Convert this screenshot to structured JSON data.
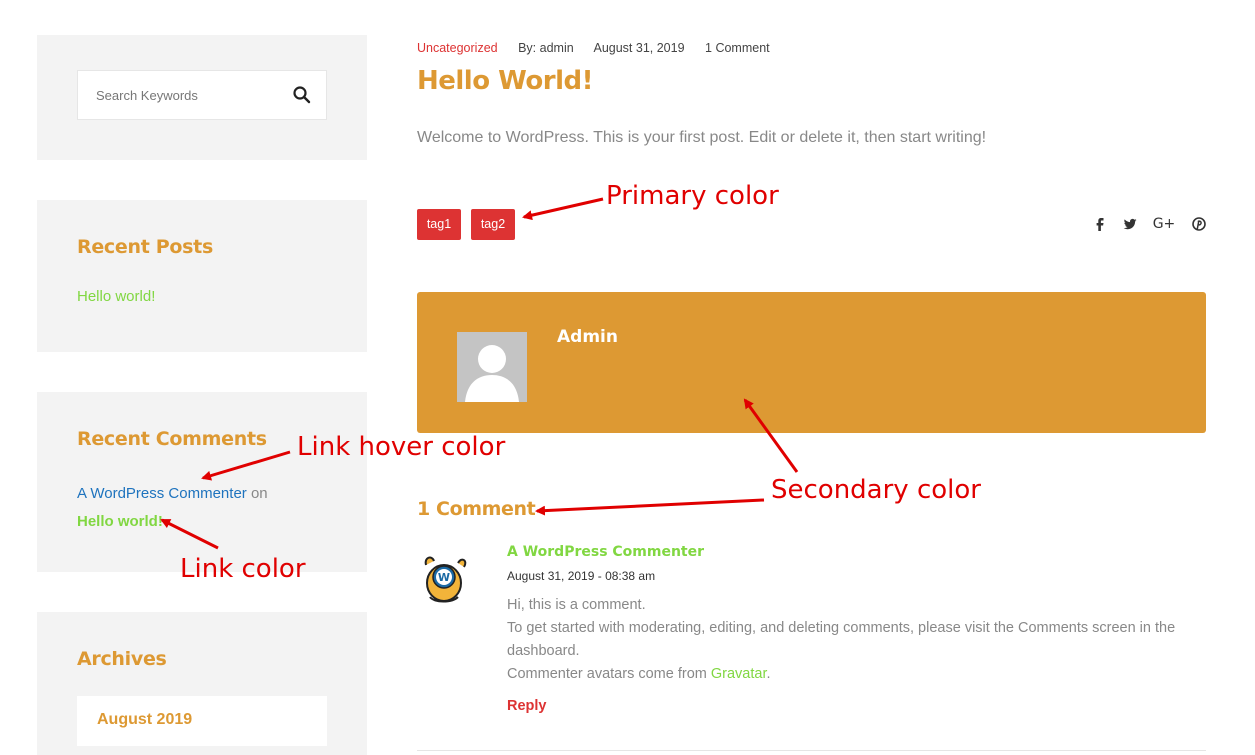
{
  "sidebar": {
    "search": {
      "placeholder": "Search Keywords",
      "icon": "search-icon"
    },
    "recent_posts": {
      "title": "Recent Posts",
      "items": [
        "Hello world!"
      ]
    },
    "recent_comments": {
      "title": "Recent Comments",
      "items": [
        {
          "author": "A WordPress Commenter",
          "on": "on",
          "post": "Hello world!"
        }
      ]
    },
    "archives": {
      "title": "Archives",
      "items": [
        "August 2019"
      ]
    }
  },
  "post": {
    "category": "Uncategorized",
    "author": "By: admin",
    "date": "August 31, 2019",
    "comment_count": "1 Comment",
    "title": "Hello World!",
    "body": "Welcome to WordPress. This is your first post. Edit or delete it, then start writing!",
    "tags": [
      "tag1",
      "tag2"
    ],
    "share_icons": [
      "facebook-icon",
      "twitter-icon",
      "google-plus-icon",
      "pinterest-icon"
    ],
    "share_glyphs": [
      "f",
      "🐦",
      "G+",
      "℗"
    ]
  },
  "author_box": {
    "name": "Admin"
  },
  "comments": {
    "title": "1 Comment",
    "items": [
      {
        "author": "A WordPress Commenter",
        "date": "August 31, 2019 - 08:38 am",
        "line1": "Hi, this is a comment.",
        "line2": "To get started with moderating, editing, and deleting comments, please visit the Comments screen in the dashboard.",
        "line3_prefix": "Commenter avatars come from ",
        "line3_link": "Gravatar",
        "line3_suffix": ".",
        "reply": "Reply"
      }
    ]
  },
  "annotations": {
    "primary": "Primary color",
    "link_hover": "Link hover color",
    "link": "Link color",
    "secondary": "Secondary color"
  },
  "colors": {
    "primary": "#dd3333",
    "secondary": "#dd9933",
    "link": "#81d742",
    "link_hover": "#1e73be",
    "annotation": "#e00000"
  }
}
